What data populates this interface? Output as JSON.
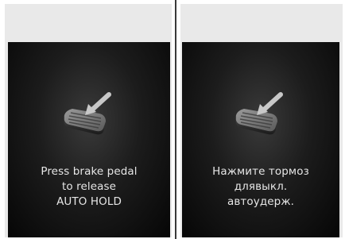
{
  "panels": [
    {
      "language": "en",
      "message_lines": [
        "Press brake pedal",
        "to release",
        "AUTO HOLD"
      ]
    },
    {
      "language": "ru",
      "message_lines": [
        "Нажмите тормоз",
        "длявыкл.",
        "автоудерж."
      ]
    }
  ],
  "colors": {
    "background": "#ffffff",
    "panel_frame": "#e9e9e9",
    "screen": "#0c0c0c",
    "text": "#e6e6e6",
    "divider": "#3a3a3a"
  },
  "icons": [
    "brake-pedal-icon",
    "press-arrow-icon"
  ]
}
